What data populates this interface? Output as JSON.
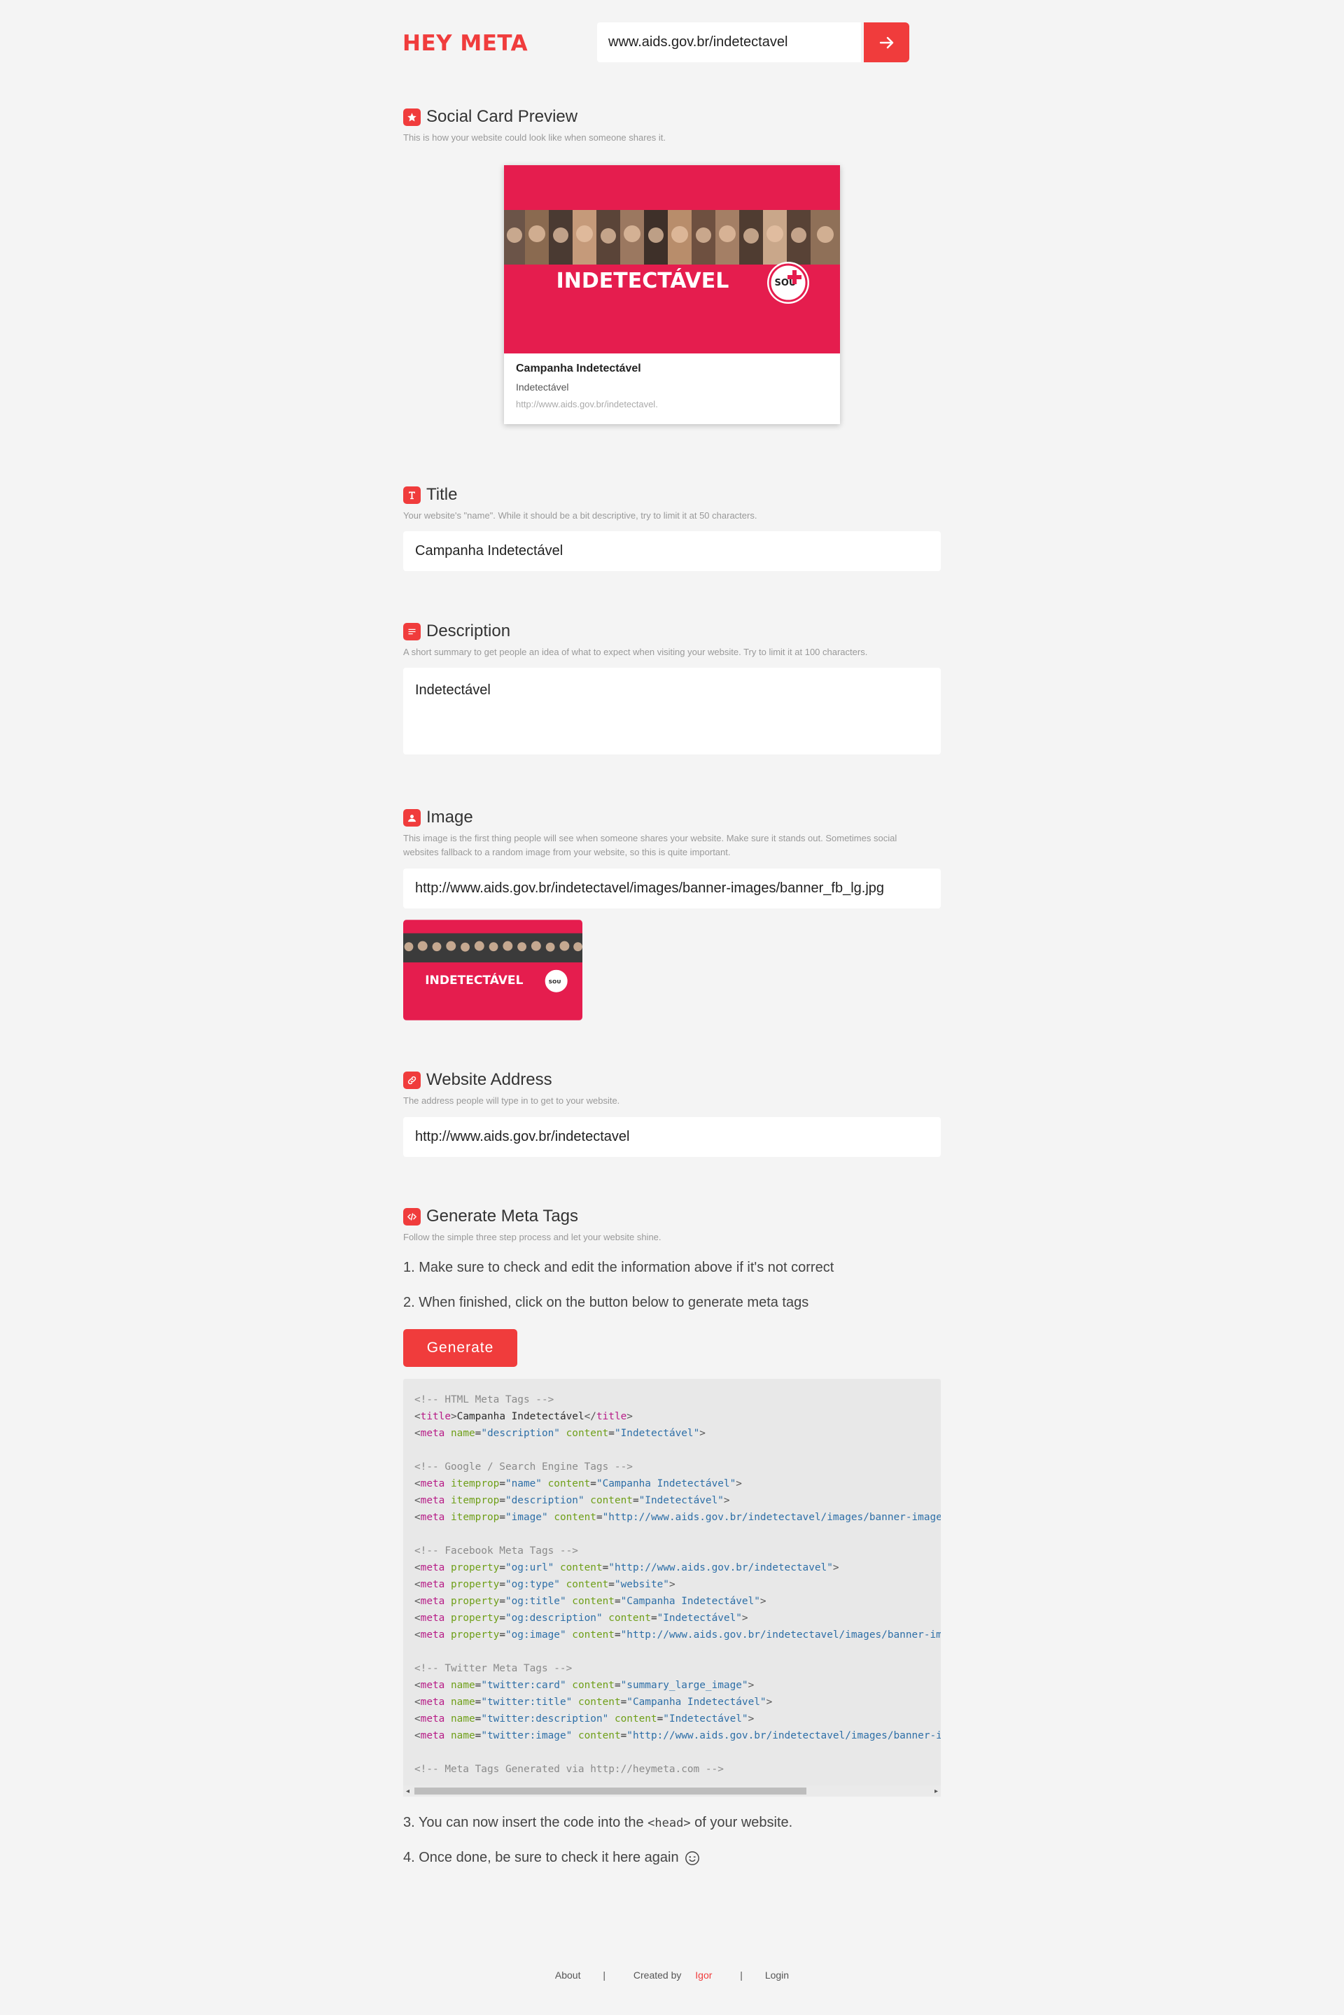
{
  "header": {
    "logo": "HEY META",
    "url_value": "www.aids.gov.br/indetectavel"
  },
  "preview": {
    "title": "Social Card Preview",
    "description": "This is how your website could look like when someone shares it.",
    "card_title": "Campanha Indetectável",
    "card_description": "Indetectável",
    "card_url": "http://www.aids.gov.br/indetectavel.",
    "banner_text": "INDETECTÁVEL",
    "badge_text": "SOU"
  },
  "title_section": {
    "title": "Title",
    "description": "Your website's \"name\". While it should be a bit descriptive, try to limit it at 50 characters.",
    "value": "Campanha Indetectável"
  },
  "description_section": {
    "title": "Description",
    "description": "A short summary to get people an idea of what to expect when visiting your website. Try to limit it at 100 characters.",
    "value": "Indetectável"
  },
  "image_section": {
    "title": "Image",
    "description_line1": "This image is the first thing people will see when someone shares your website. Make sure it stands out. Sometimes social",
    "description_line2": "websites fallback to a random image from your website, so this is quite important.",
    "value": "http://www.aids.gov.br/indetectavel/images/banner-images/banner_fb_lg.jpg"
  },
  "address_section": {
    "title": "Website Address",
    "description": "The address people will type in to get to your website.",
    "value": "http://www.aids.gov.br/indetectavel"
  },
  "generate_section": {
    "title": "Generate Meta Tags",
    "description": "Follow the simple three step process and let your website shine.",
    "step1": "1. Make sure to check and edit the information above if it's not correct",
    "step2": "2. When finished, click on the button below to generate meta tags",
    "button": "Generate",
    "step3_pre": "3. You can now insert the code into the ",
    "step3_code": "<head>",
    "step3_post": " of your website.",
    "step4": "4. Once done, be sure to check it here again"
  },
  "code": {
    "c1": "<!-- HTML Meta Tags -->",
    "c2": "<!-- Google / Search Engine Tags -->",
    "c3": "<!-- Facebook Meta Tags -->",
    "c4": "<!-- Twitter Meta Tags -->",
    "c5": "<!-- Meta Tags Generated via http://heymeta.com -->",
    "title_text": "Campanha Indetectável",
    "v_description": "\"Indetectável\"",
    "v_name_str": "\"Campanha Indetectável\"",
    "v_image": "\"http://www.aids.gov.br/indetectavel/images/banner-images/banner_fb_lg.jpg\"",
    "v_url": "\"http://www.aids.gov.br/indetectavel\"",
    "v_website": "\"website\"",
    "v_card": "\"summary_large_image\""
  },
  "footer": {
    "about": "About",
    "separator": "|",
    "created_by": "Created by",
    "author": "Igor",
    "login": "Login"
  },
  "colors": {
    "accent": "#f03c3c",
    "banner": "#e51d4e"
  }
}
